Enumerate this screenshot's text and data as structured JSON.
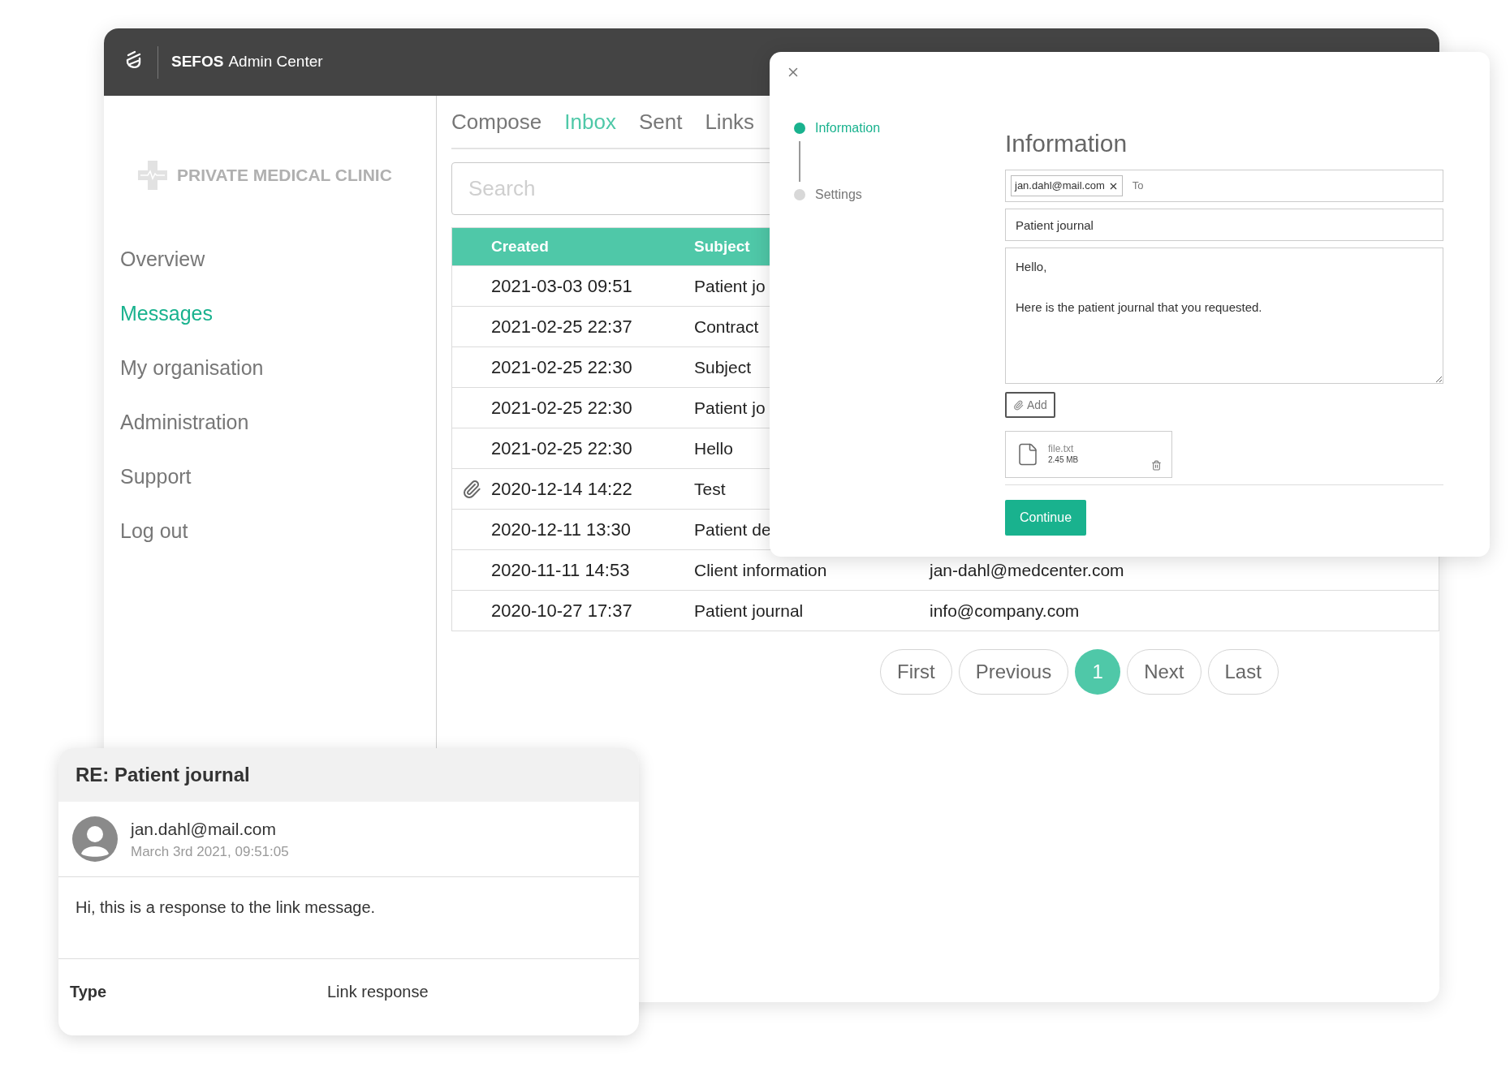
{
  "app": {
    "brand_bold": "SEFOS",
    "brand_rest": "Admin Center"
  },
  "sidebar": {
    "logo_text": "PRIVATE MEDICAL CLINIC",
    "items": [
      {
        "label": "Overview",
        "selected": false
      },
      {
        "label": "Messages",
        "selected": true
      },
      {
        "label": "My organisation",
        "selected": false
      },
      {
        "label": "Administration",
        "selected": false
      },
      {
        "label": "Support",
        "selected": false
      },
      {
        "label": "Log out",
        "selected": false
      }
    ]
  },
  "tabs": [
    {
      "label": "Compose",
      "selected": false
    },
    {
      "label": "Inbox",
      "selected": true
    },
    {
      "label": "Sent",
      "selected": false
    },
    {
      "label": "Links",
      "selected": false
    }
  ],
  "search": {
    "placeholder": "Search"
  },
  "table": {
    "columns": [
      "Created",
      "Subject"
    ],
    "rows": [
      {
        "attachment": false,
        "created": "2021-03-03 09:51",
        "subject": "Patient jo"
      },
      {
        "attachment": false,
        "created": "2021-02-25 22:37",
        "subject": "Contract"
      },
      {
        "attachment": false,
        "created": "2021-02-25 22:30",
        "subject": "Subject"
      },
      {
        "attachment": false,
        "created": "2021-02-25 22:30",
        "subject": "Patient jo"
      },
      {
        "attachment": false,
        "created": "2021-02-25 22:30",
        "subject": "Hello"
      },
      {
        "attachment": true,
        "created": "2020-12-14 14:22",
        "subject": "Test"
      },
      {
        "attachment": false,
        "created": "2020-12-11 13:30",
        "subject": "Patient de"
      },
      {
        "attachment": false,
        "created": "2020-11-11 14:53",
        "subject": "Client information",
        "sender": "jan-dahl@medcenter.com"
      },
      {
        "attachment": false,
        "created": "2020-10-27 17:37",
        "subject": "Patient journal",
        "sender": "info@company.com"
      }
    ]
  },
  "pagination": [
    {
      "label": "First",
      "selected": false
    },
    {
      "label": "Previous",
      "selected": false
    },
    {
      "label": "1",
      "selected": true
    },
    {
      "label": "Next",
      "selected": false
    },
    {
      "label": "Last",
      "selected": false
    }
  ],
  "dialog": {
    "steps": [
      {
        "label": "Information",
        "selected": true
      },
      {
        "label": "Settings",
        "selected": false
      }
    ],
    "heading": "Information",
    "recipients": [
      "jan.dahl@mail.com"
    ],
    "to_placeholder": "To",
    "subject": "Patient journal",
    "body": "Hello,\n\nHere is the patient journal that you requested.",
    "add_button": "Add",
    "attachment": {
      "name": "file.txt",
      "size": "2.45 MB"
    },
    "continue_button": "Continue"
  },
  "message_card": {
    "title": "RE: Patient journal",
    "sender": "jan.dahl@mail.com",
    "date": "March 3rd 2021, 09:51:05",
    "text": "Hi, this is a response to the link message.",
    "fields": [
      {
        "label": "Type",
        "value": "Link response"
      }
    ]
  }
}
